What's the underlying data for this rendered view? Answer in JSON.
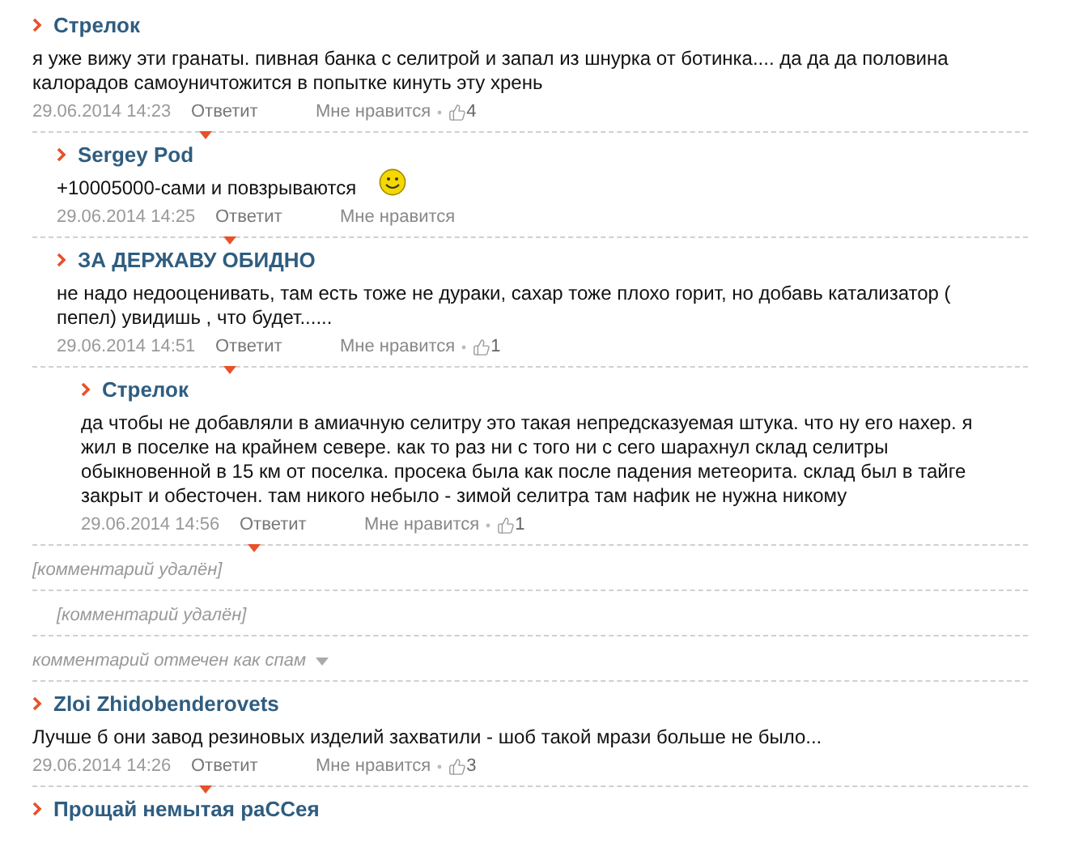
{
  "comments": [
    {
      "kind": "comment",
      "author": "Стрелок",
      "text": "я уже вижу эти гранаты. пивная банка с селитрой и запал из шнурка от ботинка.... да да да половина калорадов самоуничтожится в попытке кинуть эту хрень",
      "smiley": false,
      "date": "29.06.2014 14:23",
      "reply": "Ответит",
      "like": "Мне нравится",
      "likes": "4",
      "children": [
        {
          "kind": "comment",
          "author": "Sergey Pod",
          "text": "+10005000-сами и повзрываются",
          "smiley": true,
          "date": "29.06.2014 14:25",
          "reply": "Ответит",
          "like": "Мне нравится"
        },
        {
          "kind": "comment",
          "author": "ЗА ДЕРЖАВУ ОБИДНО",
          "text": "не надо недооценивать, там есть тоже не дураки, сахар тоже плохо горит, но добавь катализатор ( пепел) увидишь , что будет......",
          "smiley": false,
          "date": "29.06.2014 14:51",
          "reply": "Ответит",
          "like": "Мне нравится",
          "likes": "1",
          "children": [
            {
              "kind": "comment",
              "author": "Стрелок",
              "text": "да чтобы не добавляли в амиачную селитру это такая непредсказуемая штука. что ну его нахер. я жил в поселке на крайнем севере. как то раз ни с того ни с сего шарахнул склад селитры обыкновенной в 15 км от поселка. просека была как после падения метеорита. склад был в тайге закрыт и обесточен. там никого небыло - зимой селитра там нафик не нужна никому",
              "smiley": false,
              "date": "29.06.2014 14:56",
              "reply": "Ответит",
              "like": "Мне нравится",
              "likes": "1"
            }
          ]
        }
      ]
    },
    {
      "kind": "deleted",
      "text": "[комментарий удалён]",
      "children": [
        {
          "kind": "deleted",
          "text": "[комментарий удалён]"
        }
      ]
    },
    {
      "kind": "spam",
      "text": "комментарий отмечен как спам"
    },
    {
      "kind": "comment",
      "author": "Zloi Zhidobenderovets",
      "text": "Лучше б они завод резиновых изделий захватили - шоб такой мрази больше не было...",
      "smiley": false,
      "date": "29.06.2014 14:26",
      "reply": "Ответит",
      "like": "Мне нравится",
      "likes": "3"
    },
    {
      "kind": "comment",
      "author": "Прощай немытая раССея"
    }
  ]
}
